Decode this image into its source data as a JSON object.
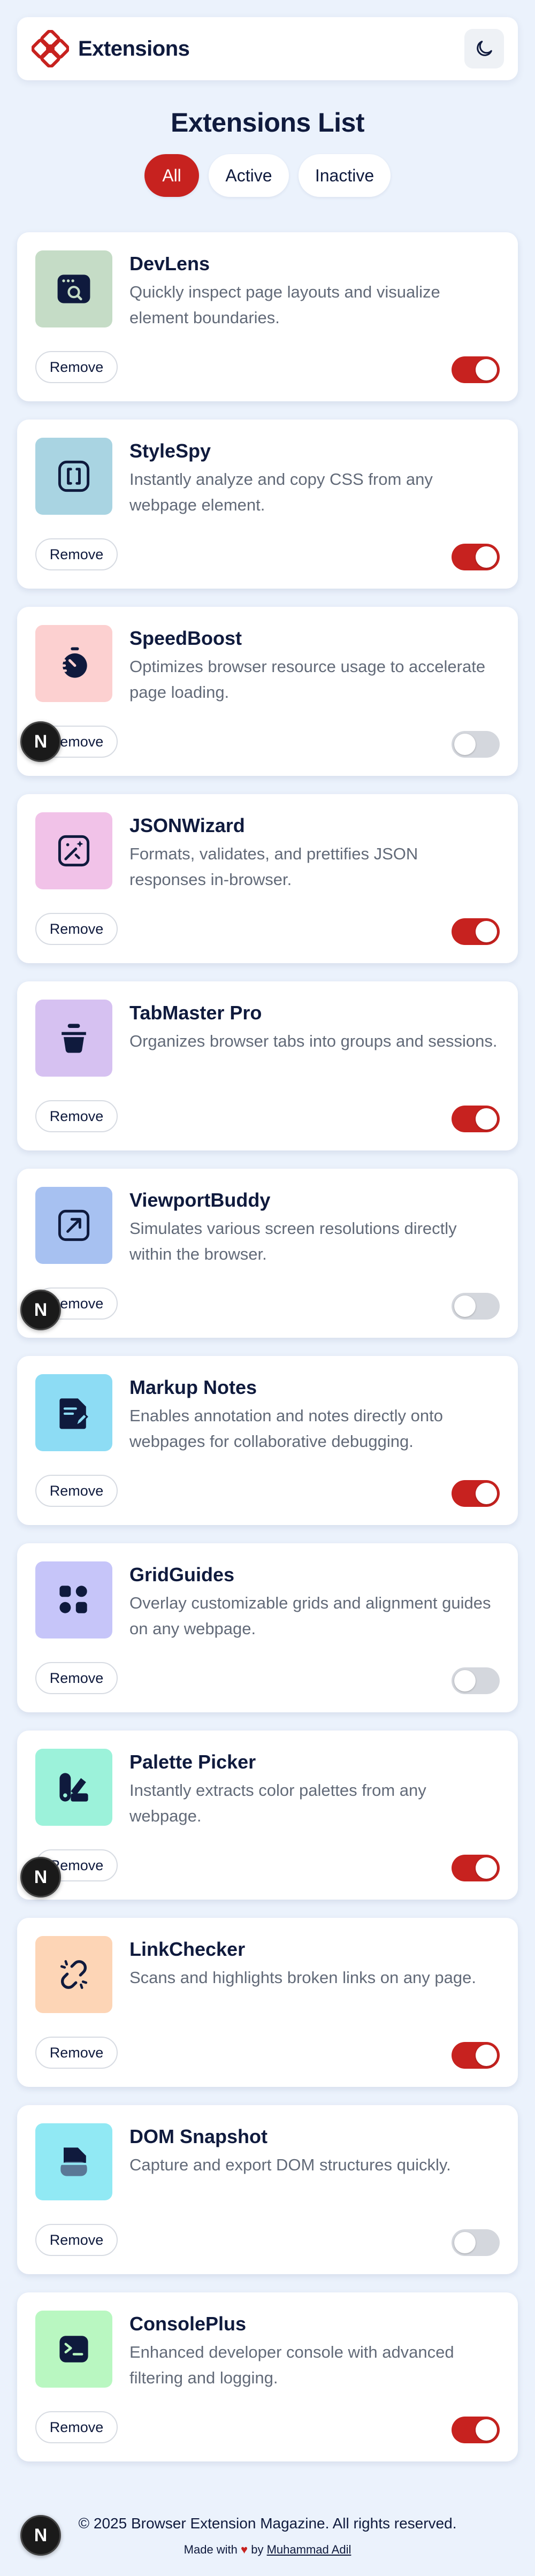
{
  "header": {
    "brand": "Extensions",
    "theme_icon": "moon-icon",
    "logo_icon": "extensions-logo-icon",
    "accent_color": "#c7221f"
  },
  "main": {
    "title": "Extensions List",
    "filters": [
      {
        "label": "All",
        "selected": true
      },
      {
        "label": "Active",
        "selected": false
      },
      {
        "label": "Inactive",
        "selected": false
      }
    ]
  },
  "extensions": [
    {
      "name": "DevLens",
      "description": "Quickly inspect page layouts and visualize element boundaries.",
      "remove_label": "Remove",
      "active": true,
      "icon": "devlens-icon",
      "icon_bg": "#c5dcc6"
    },
    {
      "name": "StyleSpy",
      "description": "Instantly analyze and copy CSS from any webpage element.",
      "remove_label": "Remove",
      "active": true,
      "icon": "stylespy-icon",
      "icon_bg": "#a9d4e2"
    },
    {
      "name": "SpeedBoost",
      "description": "Optimizes browser resource usage to accelerate page loading.",
      "remove_label": "Remove",
      "active": false,
      "icon": "speedboost-icon",
      "icon_bg": "#fcd0d0"
    },
    {
      "name": "JSONWizard",
      "description": "Formats, validates, and prettifies JSON responses in-browser.",
      "remove_label": "Remove",
      "active": true,
      "icon": "jsonwizard-icon",
      "icon_bg": "#f1c2e8"
    },
    {
      "name": "TabMaster Pro",
      "description": "Organizes browser tabs into groups and sessions.",
      "remove_label": "Remove",
      "active": true,
      "icon": "tabmaster-icon",
      "icon_bg": "#d6c1f1"
    },
    {
      "name": "ViewportBuddy",
      "description": "Simulates various screen resolutions directly within the browser.",
      "remove_label": "Remove",
      "active": false,
      "icon": "viewportbuddy-icon",
      "icon_bg": "#a7c1f1"
    },
    {
      "name": "Markup Notes",
      "description": "Enables annotation and notes directly onto webpages for collaborative debugging.",
      "remove_label": "Remove",
      "active": true,
      "icon": "markupnotes-icon",
      "icon_bg": "#8ddcf4"
    },
    {
      "name": "GridGuides",
      "description": "Overlay customizable grids and alignment guides on any webpage.",
      "remove_label": "Remove",
      "active": false,
      "icon": "gridguides-icon",
      "icon_bg": "#c6c5f9"
    },
    {
      "name": "Palette Picker",
      "description": "Instantly extracts color palettes from any webpage.",
      "remove_label": "Remove",
      "active": true,
      "icon": "palettepicker-icon",
      "icon_bg": "#9cf2da"
    },
    {
      "name": "LinkChecker",
      "description": "Scans and highlights broken links on any page.",
      "remove_label": "Remove",
      "active": true,
      "icon": "linkchecker-icon",
      "icon_bg": "#fdd5b6"
    },
    {
      "name": "DOM Snapshot",
      "description": "Capture and export DOM structures quickly.",
      "remove_label": "Remove",
      "active": false,
      "icon": "domsnapshot-icon",
      "icon_bg": "#91e9f4"
    },
    {
      "name": "ConsolePlus",
      "description": "Enhanced developer console with advanced filtering and logging.",
      "remove_label": "Remove",
      "active": true,
      "icon": "consoleplus-icon",
      "icon_bg": "#b9f7c1"
    }
  ],
  "footer": {
    "copyright": "© 2025 Browser Extension Magazine. All rights reserved.",
    "made_with_prefix": "Made with",
    "heart": "♥",
    "by_text": "by",
    "author": "Muhammad Adil"
  },
  "overlay": {
    "badge_letter": "N"
  }
}
